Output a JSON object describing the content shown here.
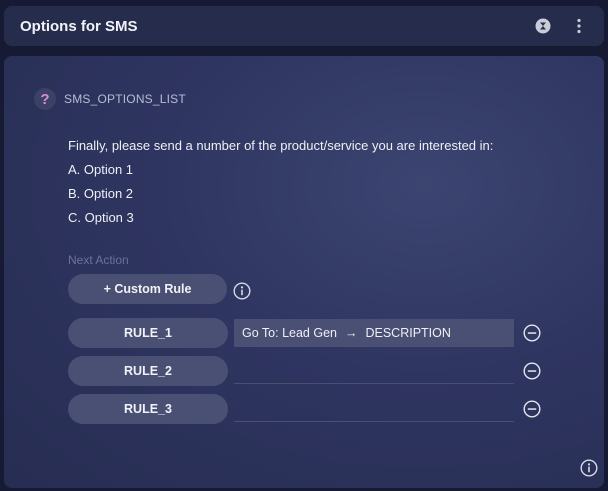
{
  "header": {
    "title": "Options for SMS"
  },
  "node": {
    "name": "SMS_OPTIONS_LIST",
    "icon": "question-icon"
  },
  "message": {
    "lines": [
      "Finally, please send a number of the product/service you are interested in:",
      "A.  Option 1",
      "B.  Option 2",
      "C.  Option 3"
    ]
  },
  "next_action": {
    "label": "Next Action",
    "custom_rule_label": "+ Custom Rule"
  },
  "rules": [
    {
      "name": "RULE_1",
      "target_prefix": "Go To: Lead Gen",
      "arrow": "→",
      "target_node": "DESCRIPTION"
    },
    {
      "name": "RULE_2",
      "target_prefix": "",
      "arrow": "",
      "target_node": ""
    },
    {
      "name": "RULE_3",
      "target_prefix": "",
      "arrow": "",
      "target_node": ""
    }
  ],
  "colors": {
    "background": "#161a33",
    "panel": "#2e3560",
    "pill": "#4a5073",
    "question_accent": "#d98bd7"
  }
}
